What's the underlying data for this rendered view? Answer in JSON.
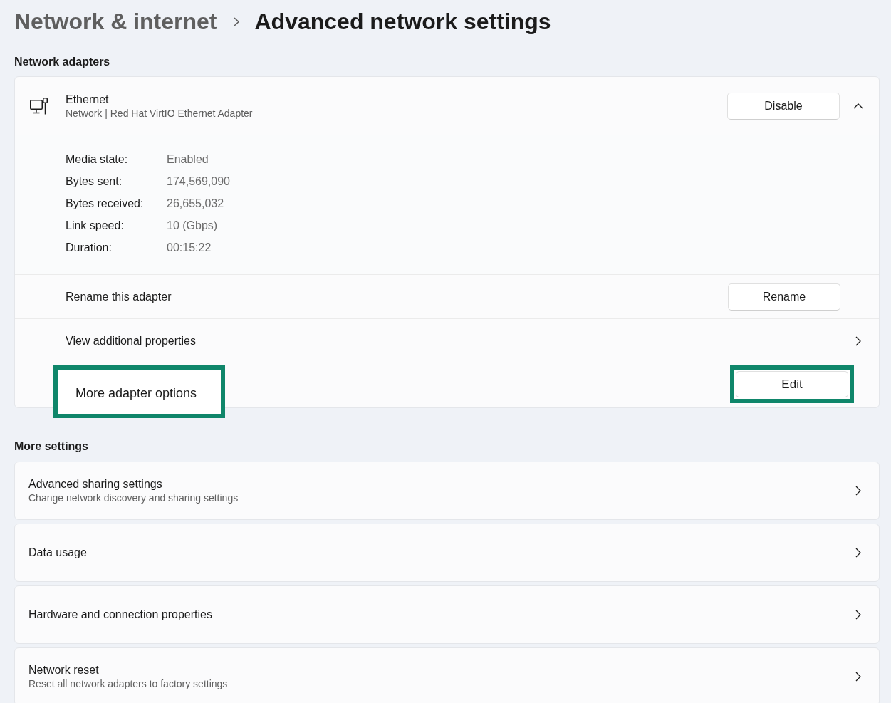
{
  "breadcrumb": [
    {
      "label": "Network & internet",
      "selected": false
    },
    {
      "label": "Advanced network settings",
      "selected": true
    }
  ],
  "network_adapters": {
    "title": "Network adapters",
    "adapter": {
      "name": "Ethernet",
      "description": "Network | Red Hat VirtIO Ethernet Adapter",
      "button": "Disable",
      "expanded": true,
      "details": [
        {
          "label": "Media state:",
          "value": "Enabled"
        },
        {
          "label": "Bytes sent:",
          "value": "174,569,090"
        },
        {
          "label": "Bytes received:",
          "value": "26,655,032"
        },
        {
          "label": "Link speed:",
          "value": "10 (Gbps)"
        },
        {
          "label": "Duration:",
          "value": "00:15:22"
        }
      ],
      "rows": [
        {
          "kind": "button",
          "label": "Rename this adapter",
          "button": "Rename",
          "highlighted": false
        },
        {
          "kind": "link",
          "label": "View additional properties",
          "highlighted": false
        },
        {
          "kind": "button",
          "label": "More adapter options",
          "button": "Edit",
          "highlighted": true
        }
      ]
    }
  },
  "more_settings": {
    "title": "More settings",
    "items": [
      {
        "title": "Advanced sharing settings",
        "subtitle": "Change network discovery and sharing settings"
      },
      {
        "title": "Data usage"
      },
      {
        "title": "Hardware and connection properties"
      },
      {
        "title": "Network reset",
        "subtitle": "Reset all network adapters to factory settings"
      }
    ]
  }
}
